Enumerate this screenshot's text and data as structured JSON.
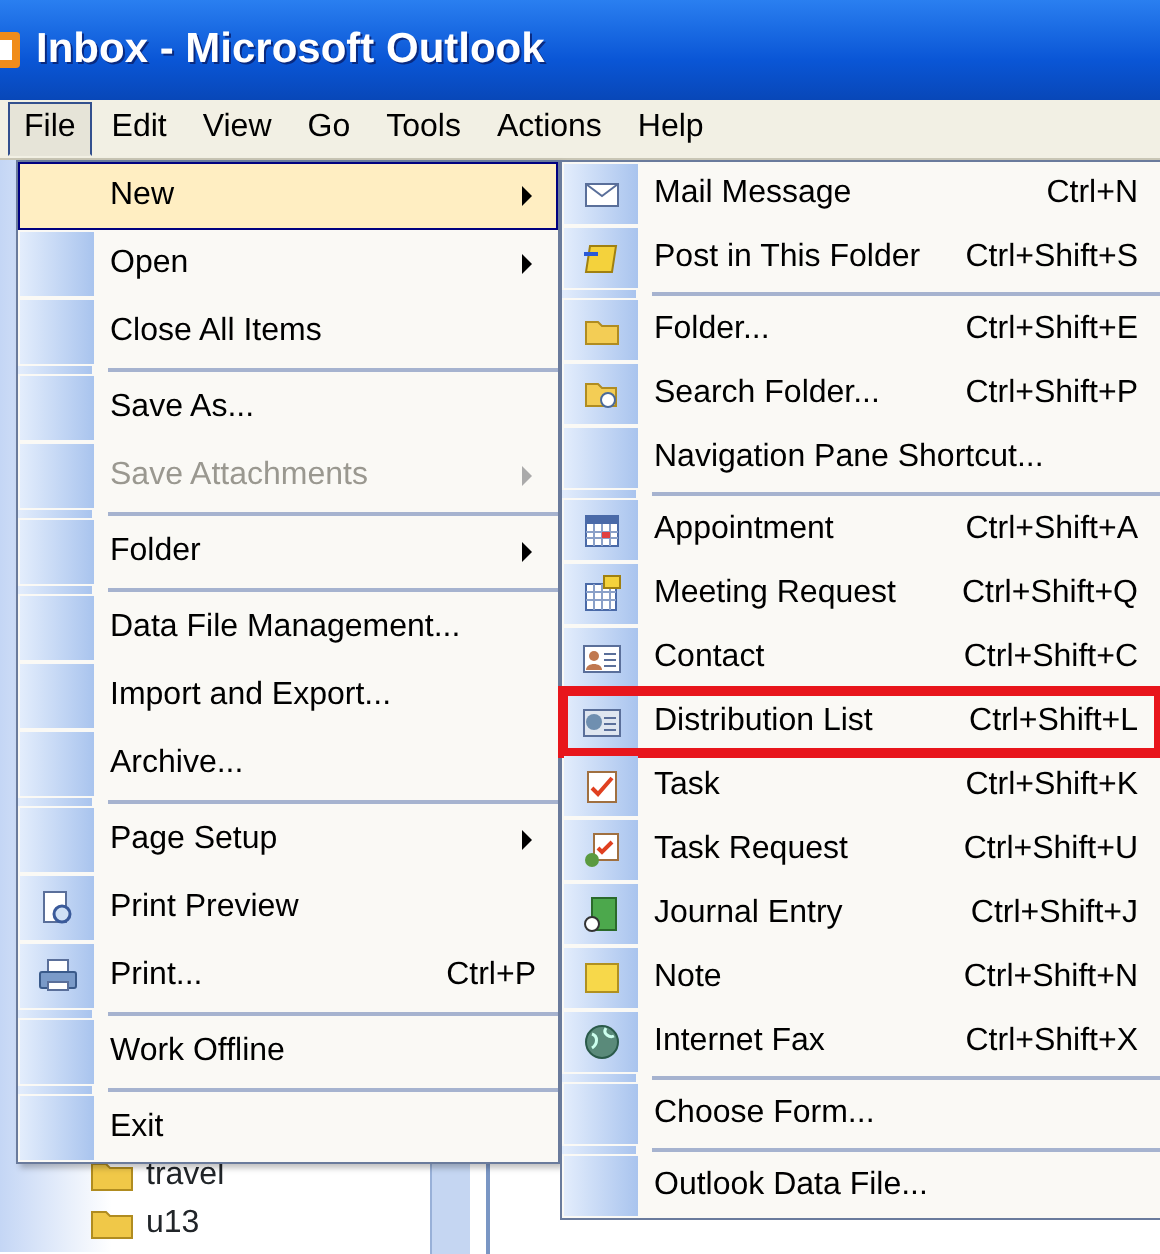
{
  "window": {
    "title": "Inbox - Microsoft Outlook"
  },
  "menu_bar": [
    {
      "label": "File",
      "selected": true
    },
    {
      "label": "Edit",
      "selected": false
    },
    {
      "label": "View",
      "selected": false
    },
    {
      "label": "Go",
      "selected": false
    },
    {
      "label": "Tools",
      "selected": false
    },
    {
      "label": "Actions",
      "selected": false
    },
    {
      "label": "Help",
      "selected": false
    }
  ],
  "file_menu": [
    {
      "kind": "item",
      "label": "New",
      "submenu": true,
      "selected": true,
      "disabled": false
    },
    {
      "kind": "item",
      "label": "Open",
      "submenu": true,
      "selected": false,
      "disabled": false
    },
    {
      "kind": "item",
      "label": "Close All Items",
      "selected": false,
      "disabled": false
    },
    {
      "kind": "separator"
    },
    {
      "kind": "item",
      "label": "Save As...",
      "selected": false,
      "disabled": false
    },
    {
      "kind": "item",
      "label": "Save Attachments",
      "submenu": true,
      "selected": false,
      "disabled": true
    },
    {
      "kind": "separator"
    },
    {
      "kind": "item",
      "label": "Folder",
      "submenu": true,
      "selected": false,
      "disabled": false
    },
    {
      "kind": "separator"
    },
    {
      "kind": "item",
      "label": "Data File Management...",
      "selected": false,
      "disabled": false
    },
    {
      "kind": "item",
      "label": "Import and Export...",
      "selected": false,
      "disabled": false
    },
    {
      "kind": "item",
      "label": "Archive...",
      "selected": false,
      "disabled": false
    },
    {
      "kind": "separator"
    },
    {
      "kind": "item",
      "label": "Page Setup",
      "submenu": true,
      "selected": false,
      "disabled": false
    },
    {
      "kind": "item",
      "label": "Print Preview",
      "selected": false,
      "disabled": false
    },
    {
      "kind": "item",
      "label": "Print...",
      "shortcut": "Ctrl+P",
      "selected": false,
      "disabled": false
    },
    {
      "kind": "separator"
    },
    {
      "kind": "item",
      "label": "Work Offline",
      "selected": false,
      "disabled": false
    },
    {
      "kind": "separator"
    },
    {
      "kind": "item",
      "label": "Exit",
      "selected": false,
      "disabled": false
    }
  ],
  "new_submenu": [
    {
      "kind": "item",
      "label": "Mail Message",
      "shortcut": "Ctrl+N",
      "highlighted": false
    },
    {
      "kind": "item",
      "label": "Post in This Folder",
      "shortcut": "Ctrl+Shift+S",
      "highlighted": false
    },
    {
      "kind": "separator"
    },
    {
      "kind": "item",
      "label": "Folder...",
      "shortcut": "Ctrl+Shift+E",
      "highlighted": false
    },
    {
      "kind": "item",
      "label": "Search Folder...",
      "shortcut": "Ctrl+Shift+P",
      "highlighted": false
    },
    {
      "kind": "item",
      "label": "Navigation Pane Shortcut...",
      "highlighted": false
    },
    {
      "kind": "separator"
    },
    {
      "kind": "item",
      "label": "Appointment",
      "shortcut": "Ctrl+Shift+A",
      "highlighted": false
    },
    {
      "kind": "item",
      "label": "Meeting Request",
      "shortcut": "Ctrl+Shift+Q",
      "highlighted": false
    },
    {
      "kind": "item",
      "label": "Contact",
      "shortcut": "Ctrl+Shift+C",
      "highlighted": false
    },
    {
      "kind": "item",
      "label": "Distribution List",
      "shortcut": "Ctrl+Shift+L",
      "highlighted": true
    },
    {
      "kind": "item",
      "label": "Task",
      "shortcut": "Ctrl+Shift+K",
      "highlighted": false
    },
    {
      "kind": "item",
      "label": "Task Request",
      "shortcut": "Ctrl+Shift+U",
      "highlighted": false
    },
    {
      "kind": "item",
      "label": "Journal Entry",
      "shortcut": "Ctrl+Shift+J",
      "highlighted": false
    },
    {
      "kind": "item",
      "label": "Note",
      "shortcut": "Ctrl+Shift+N",
      "highlighted": false
    },
    {
      "kind": "item",
      "label": "Internet Fax",
      "shortcut": "Ctrl+Shift+X",
      "highlighted": false
    },
    {
      "kind": "separator"
    },
    {
      "kind": "item",
      "label": "Choose Form...",
      "highlighted": false
    },
    {
      "kind": "separator"
    },
    {
      "kind": "item",
      "label": "Outlook Data File...",
      "highlighted": false
    }
  ],
  "folder_list": [
    {
      "label": "travel"
    },
    {
      "label": "u13"
    }
  ]
}
